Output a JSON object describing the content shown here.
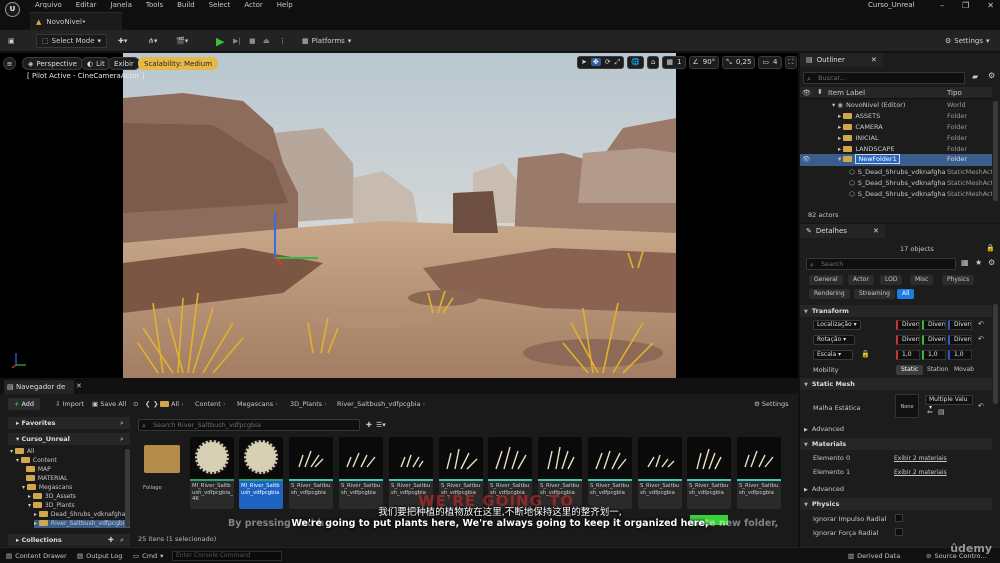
{
  "menu": {
    "logo": "U",
    "items": [
      "Arquivo",
      "Editar",
      "Janela",
      "Tools",
      "Build",
      "Select",
      "Actor",
      "Help"
    ],
    "project": "Curso_Unreal",
    "level_tab": "NovoNivel•"
  },
  "toolbar": {
    "select_mode": "Select Mode",
    "platforms": "Platforms",
    "settings": "Settings"
  },
  "viewport": {
    "perspective": "Perspective",
    "lit": "Lit",
    "show": "Exibir",
    "scalability": "Scalability: Medium",
    "pilot": "[ Pilot Active - CineCameraActor ]",
    "fov": "90°",
    "snap_scale": "0,25",
    "camera_speed": "4",
    "grid_count": "1"
  },
  "outliner": {
    "tab": "Outliner",
    "search_placeholder": "Buscar...",
    "col_label": "Item Label",
    "col_type": "Tipo",
    "rows": [
      {
        "label": "NovoNivel (Editor)",
        "type": "World"
      },
      {
        "label": "ASSETS",
        "type": "Folder"
      },
      {
        "label": "CAMERA",
        "type": "Folder"
      },
      {
        "label": "INICIAL",
        "type": "Folder"
      },
      {
        "label": "LANDSCAPE",
        "type": "Folder"
      },
      {
        "label": "NewFolder1",
        "type": "Folder"
      },
      {
        "label": "S_Dead_Shrubs_vdknafgha",
        "type": "StaticMeshAct"
      },
      {
        "label": "S_Dead_Shrubs_vdknafgha",
        "type": "StaticMeshAct"
      },
      {
        "label": "S_Dead_Shrubs_vdknafgha",
        "type": "StaticMeshAct"
      }
    ],
    "count": "82 actors"
  },
  "details": {
    "tab": "Detalhes",
    "objects": "17 objects",
    "search_placeholder": "Search",
    "filters_row1": [
      "General",
      "Actor",
      "LOD",
      "Misc",
      "Physics"
    ],
    "filters_row2": [
      "Rendering",
      "Streaming",
      "All"
    ],
    "transform": "Transform",
    "location": "Localização",
    "rotation": "Rotação",
    "scale": "Escala",
    "mult": "Diversc",
    "scale_val": "1,0",
    "mobility": "Mobility",
    "mobility_opts": [
      "Static",
      "Station",
      "Movab"
    ],
    "static_mesh_sect": "Static Mesh",
    "static_mesh_label": "Malha Estática",
    "none": "None",
    "multiple_values": "Multiple Valu",
    "advanced": "Advanced",
    "materials": "Materials",
    "element0": "Elemento 0",
    "element1": "Elemento 1",
    "show_materials": "Exibir 2 materiais",
    "physics": "Physics",
    "ignore_impulse": "Ignorar Impulso Radial",
    "ignore_force": "Ignorar Força Radial"
  },
  "content_browser": {
    "tab": "Navegador de C...",
    "add": "Add",
    "import": "Import",
    "save_all": "Save All",
    "breadcrumb": [
      "All",
      "Content",
      "Megascans",
      "3D_Plants",
      "River_Saltbush_vdfpcgbia"
    ],
    "settings": "Settings",
    "favorites": "Favorites",
    "project": "Curso_Unreal",
    "tree": [
      "All",
      "Content",
      "MAP",
      "MATERIAL",
      "Megascans",
      "3D_Assets",
      "3D_Plants",
      "Dead_Shrubs_vdknafgha",
      "River_Saltbush_vdfpcgbia"
    ],
    "search_placeholder": "Search River_Saltbush_vdfpcgbia",
    "tiles": [
      "Foliage",
      "MI_River_Saltbush_vdfpcgbia_4K",
      "MI_River_Saltbush_vdfpcgbia",
      "S_River_Saltbush_vdfpcgbia",
      "S_River_Saltbush_vdfpcgbia",
      "S_River_Saltbush_vdfpcgbia",
      "S_River_Saltbush_vdfpcgbia",
      "S_River_Saltbush_vdfpcgbia",
      "S_River_Saltbush_vdfpcgbia",
      "S_River_Saltbush_vdfpcgbia",
      "S_River_Saltbush_vdfpcgbia",
      "S_River_Saltbush_vdfpcgbia",
      "S_River_Saltbush_vdfpcgbia"
    ],
    "status": "25 itens (1 selecionado)",
    "collections": "Collections"
  },
  "bottom": {
    "content_drawer": "Content Drawer",
    "output_log": "Output Log",
    "cmd": "Cmd",
    "console_placeholder": "Enter Console Command",
    "derived_data": "Derived Data",
    "source_control": "Source Contro..."
  },
  "subtitles": {
    "overlay_big": "WE'RE GOING TO",
    "chinese": "我们要把种植的植物放在这里,不断地保持这里的整齐划一,",
    "english": "We're going to put plants here, We're always going to keep it organized here,",
    "ghost_left": "By pressing and h",
    "ghost_right": "reate new folder,",
    "watermark": "ûdemy"
  },
  "colors": {
    "accent_blue": "#1f7ce0",
    "folder_yellow": "#d1a74e",
    "scalability_chip": "#e8b74a",
    "play_green": "#37c53b",
    "mesh_teal": "#3fc7c0"
  }
}
